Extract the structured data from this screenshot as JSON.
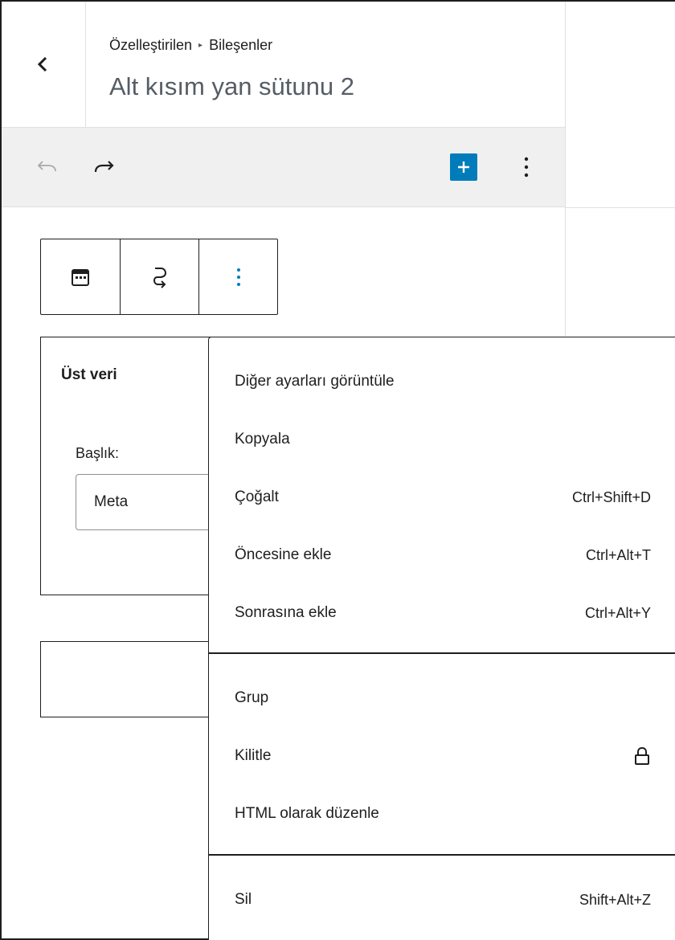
{
  "header": {
    "breadcrumb": [
      "Özelleştirilen",
      "Bileşenler"
    ],
    "breadcrumb_separator": "▸",
    "title": "Alt kısım yan sütunu 2"
  },
  "widget": {
    "title": "Üst veri",
    "field_label": "Başlık:",
    "field_value": "Meta"
  },
  "menu": {
    "groups": [
      {
        "items": [
          {
            "label": "Diğer ayarları görüntüle",
            "shortcut": ""
          },
          {
            "label": "Kopyala",
            "shortcut": ""
          },
          {
            "label": "Çoğalt",
            "shortcut": "Ctrl+Shift+D"
          },
          {
            "label": "Öncesine ekle",
            "shortcut": "Ctrl+Alt+T"
          },
          {
            "label": "Sonrasına ekle",
            "shortcut": "Ctrl+Alt+Y"
          }
        ]
      },
      {
        "items": [
          {
            "label": "Grup",
            "shortcut": ""
          },
          {
            "label": "Kilitle",
            "shortcut": "",
            "icon": "lock-icon"
          },
          {
            "label": "HTML olarak düzenle",
            "shortcut": ""
          }
        ]
      },
      {
        "items": [
          {
            "label": "Sil",
            "shortcut": "Shift+Alt+Z"
          }
        ]
      }
    ]
  },
  "colors": {
    "accent": "#007cba",
    "toolbar_bg": "#f0f0f0",
    "disabled": "#a7aaad"
  }
}
